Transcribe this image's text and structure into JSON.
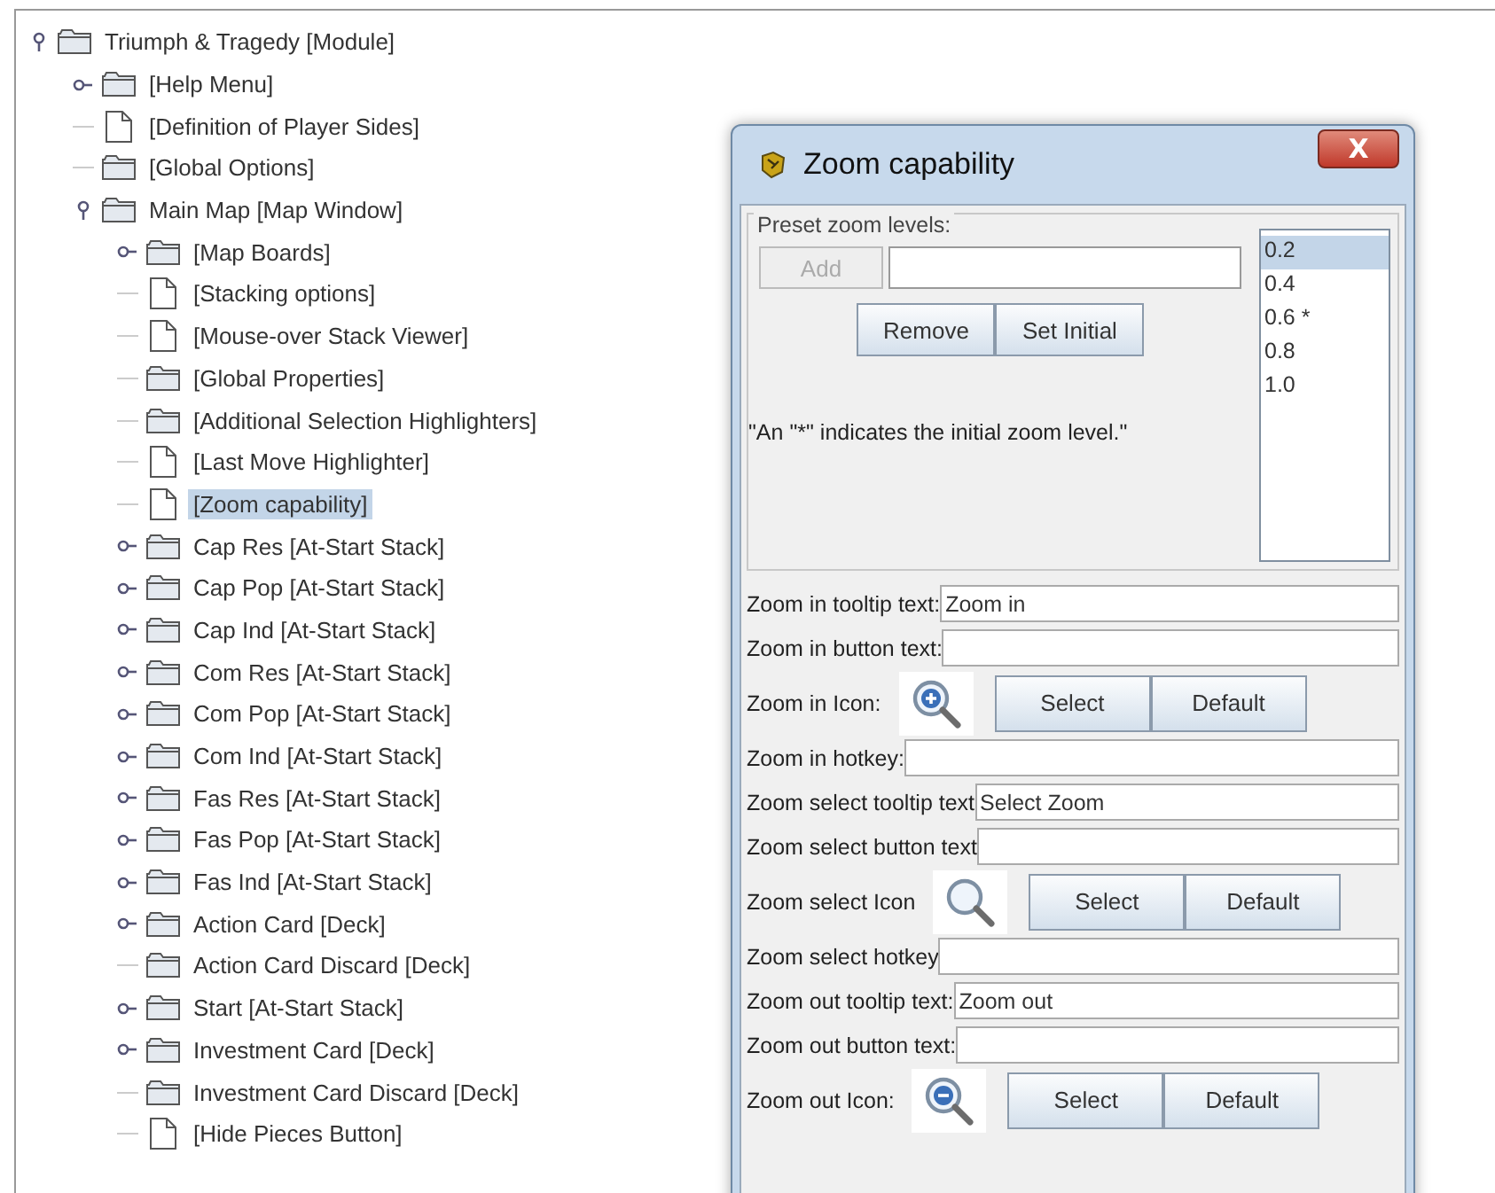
{
  "tree": [
    {
      "label": "Triumph & Tragedy [Module]",
      "kind": "folder",
      "expanded": true,
      "selected": false,
      "children": [
        {
          "label": "[Help Menu]",
          "kind": "folder",
          "expanded": false,
          "selected": false
        },
        {
          "label": "[Definition of Player Sides]",
          "kind": "document",
          "selected": false
        },
        {
          "label": "[Global Options]",
          "kind": "folder",
          "selected": false
        },
        {
          "label": "Main Map [Map Window]",
          "kind": "folder",
          "expanded": true,
          "selected": false,
          "children": [
            {
              "label": "[Map Boards]",
              "kind": "folder",
              "expanded": false,
              "selected": false
            },
            {
              "label": "[Stacking options]",
              "kind": "document",
              "selected": false
            },
            {
              "label": "[Mouse-over Stack Viewer]",
              "kind": "document",
              "selected": false
            },
            {
              "label": "[Global Properties]",
              "kind": "folder",
              "selected": false
            },
            {
              "label": "[Additional Selection Highlighters]",
              "kind": "folder",
              "selected": false
            },
            {
              "label": "[Last Move Highlighter]",
              "kind": "document",
              "selected": false
            },
            {
              "label": "[Zoom capability]",
              "kind": "document",
              "selected": true
            },
            {
              "label": "Cap Res [At-Start Stack]",
              "kind": "folder",
              "expanded": false,
              "selected": false
            },
            {
              "label": "Cap Pop [At-Start Stack]",
              "kind": "folder",
              "expanded": false,
              "selected": false
            },
            {
              "label": "Cap Ind [At-Start Stack]",
              "kind": "folder",
              "expanded": false,
              "selected": false
            },
            {
              "label": "Com Res [At-Start Stack]",
              "kind": "folder",
              "expanded": false,
              "selected": false
            },
            {
              "label": "Com Pop [At-Start Stack]",
              "kind": "folder",
              "expanded": false,
              "selected": false
            },
            {
              "label": "Com Ind [At-Start Stack]",
              "kind": "folder",
              "expanded": false,
              "selected": false
            },
            {
              "label": "Fas Res [At-Start Stack]",
              "kind": "folder",
              "expanded": false,
              "selected": false
            },
            {
              "label": "Fas Pop [At-Start Stack]",
              "kind": "folder",
              "expanded": false,
              "selected": false
            },
            {
              "label": "Fas Ind [At-Start Stack]",
              "kind": "folder",
              "expanded": false,
              "selected": false
            },
            {
              "label": "Action Card [Deck]",
              "kind": "folder",
              "expanded": false,
              "selected": false
            },
            {
              "label": "Action Card Discard [Deck]",
              "kind": "folder",
              "selected": false
            },
            {
              "label": "Start [At-Start Stack]",
              "kind": "folder",
              "expanded": false,
              "selected": false
            },
            {
              "label": "Investment Card [Deck]",
              "kind": "folder",
              "expanded": false,
              "selected": false
            },
            {
              "label": "Investment Card Discard [Deck]",
              "kind": "folder",
              "selected": false
            },
            {
              "label": "[Hide Pieces Button]",
              "kind": "document",
              "selected": false
            }
          ]
        }
      ]
    }
  ],
  "dialog": {
    "title": "Zoom capability",
    "close": "X",
    "preset": {
      "legend": "Preset zoom levels:",
      "add_button": {
        "label": "Add",
        "disabled": true
      },
      "remove_button": "Remove",
      "set_initial_button": "Set Initial",
      "note": "\"An \"*\" indicates the initial zoom level.\"",
      "levels": [
        {
          "label": "0.2",
          "selected": true
        },
        {
          "label": "0.4",
          "selected": false
        },
        {
          "label": "0.6 *",
          "selected": false
        },
        {
          "label": "0.8",
          "selected": false
        },
        {
          "label": "1.0",
          "selected": false
        }
      ]
    },
    "rows": [
      {
        "kind": "text",
        "label": "Zoom in tooltip text:",
        "value": "Zoom in"
      },
      {
        "kind": "text",
        "label": "Zoom in button text:"
      },
      {
        "kind": "icon",
        "label": "Zoom in Icon:",
        "select": "Select",
        "default": "Default"
      },
      {
        "kind": "text",
        "label": "Zoom in hotkey:"
      },
      {
        "kind": "text",
        "label": "Zoom select tooltip text",
        "value": "Select Zoom"
      },
      {
        "kind": "text",
        "label": "Zoom select button text"
      },
      {
        "kind": "icon",
        "label": "Zoom select Icon",
        "select": "Select",
        "default": "Default"
      },
      {
        "kind": "text",
        "label": "Zoom select hotkey"
      },
      {
        "kind": "text",
        "label": "Zoom out tooltip text:",
        "value": "Zoom out"
      },
      {
        "kind": "text",
        "label": "Zoom out button text:"
      },
      {
        "kind": "icon",
        "label": "Zoom out Icon:",
        "select": "Select",
        "default": "Default"
      }
    ]
  }
}
